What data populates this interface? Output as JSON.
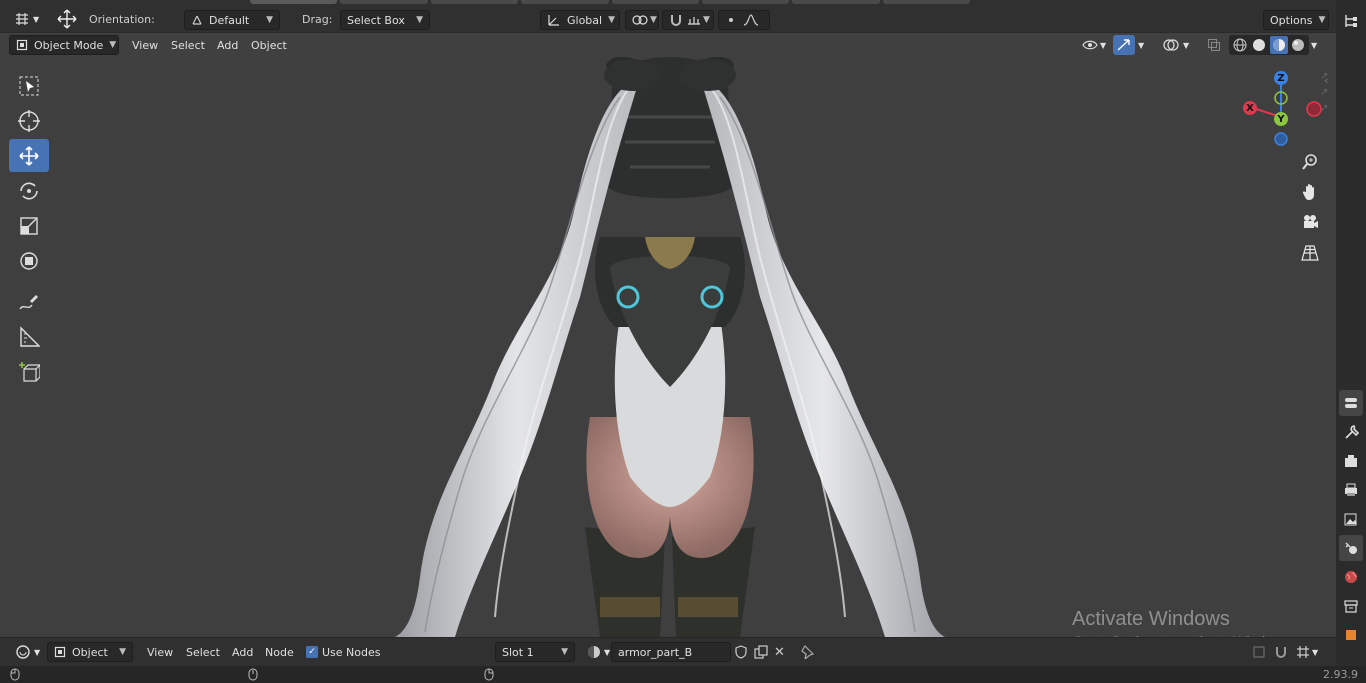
{
  "topbar": {
    "orientation_label": "Orientation:",
    "orientation_value": "Default",
    "drag_label": "Drag:",
    "drag_value": "Select Box",
    "transform_space": "Global",
    "options_label": "Options"
  },
  "viewport_header": {
    "mode": "Object Mode",
    "menus": [
      "View",
      "Select",
      "Add",
      "Object"
    ]
  },
  "navigation_gizmo": {
    "axis_z": "Z",
    "axis_y": "Y",
    "axis_x": "X",
    "colors": {
      "x": "#e0394f",
      "y": "#8cc63f",
      "z": "#3b82e6"
    }
  },
  "node_editor_header": {
    "mode": "Object",
    "menus": [
      "View",
      "Select",
      "Add",
      "Node"
    ],
    "use_nodes_label": "Use Nodes",
    "use_nodes_checked": true,
    "slot": "Slot 1",
    "material_name": "armor_part_B"
  },
  "watermark": {
    "line1": "Activate Windows",
    "line2": "Go to Settings to activate Windows."
  },
  "status": {
    "version": "2.93.9"
  },
  "colors": {
    "accent": "#4772b3",
    "background": "#3f3f3f"
  }
}
